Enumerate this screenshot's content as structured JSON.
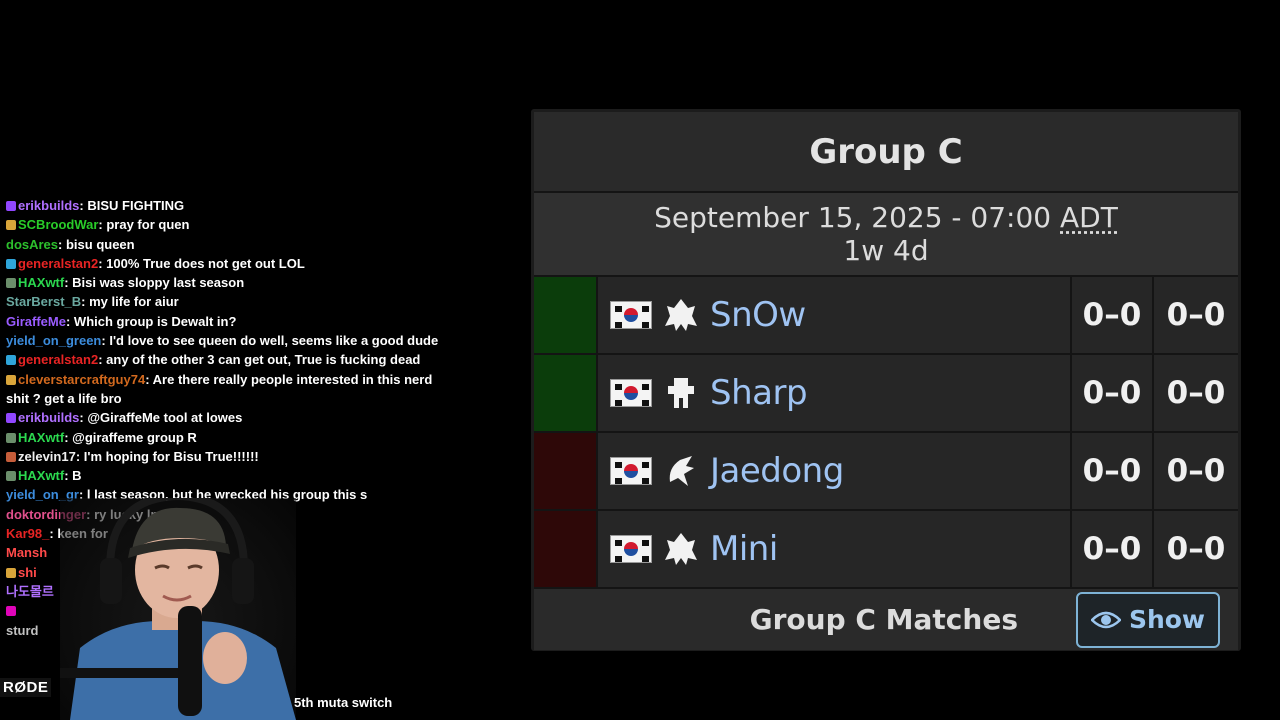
{
  "chat": {
    "messages": [
      {
        "badge": "sub",
        "user": "erikbuilds",
        "color": "#b070ff",
        "text": "BISU FIGHTING"
      },
      {
        "badge": "bits",
        "user": "SCBroodWar",
        "color": "#29cc29",
        "text": "pray for quen"
      },
      {
        "badge": "",
        "user": "dosAres",
        "color": "#2dc02d",
        "text": "bisu queen"
      },
      {
        "badge": "prime",
        "user": "generalstan2",
        "color": "#e82424",
        "text": "100% True does not get out LOL"
      },
      {
        "badge": "gift",
        "user": "HAXwtf",
        "color": "#2bd84f",
        "text": "Bisi was sloppy last season"
      },
      {
        "badge": "",
        "user": "StarBerst_B",
        "color": "#6aa8a0",
        "text": "my life for aiur"
      },
      {
        "badge": "",
        "user": "GiraffeMe",
        "color": "#9a5cff",
        "text": "Which group is Dewalt in?"
      },
      {
        "badge": "",
        "user": "yield_on_green",
        "color": "#3c8cdc",
        "text": "I'd love to see queen do well, seems like a good dude"
      },
      {
        "badge": "prime",
        "user": "generalstan2",
        "color": "#e82424",
        "text": "any of the other 3 can get out, True is fucking dead"
      },
      {
        "badge": "bits",
        "user": "cleverstarcraftguy74",
        "color": "#d2691e",
        "text": "Are there really people interested in this nerd shit ? get a life bro"
      },
      {
        "badge": "sub",
        "user": "erikbuilds",
        "color": "#b070ff",
        "text": "@GiraffeMe tool at lowes"
      },
      {
        "badge": "gift",
        "user": "HAXwtf",
        "color": "#2bd84f",
        "text": "@giraffeme group R"
      },
      {
        "badge": "mod",
        "user": "zelevin17",
        "color": "#f0f0f0",
        "text": "I'm hoping for Bisu True!!!!!!"
      },
      {
        "badge": "gift",
        "user": "HAXwtf",
        "color": "#2bd84f",
        "text": "B"
      },
      {
        "badge": "",
        "user": "yield_on_gr",
        "color": "#3c8cdc",
        "text": "l last season, but he wrecked his group this s"
      },
      {
        "badge": "",
        "user": "doktordinger",
        "color": "#e0508c",
        "text": "ry lucky lmao"
      },
      {
        "badge": "",
        "user": "Kar98_",
        "color": "#e82424",
        "text": "keen for"
      },
      {
        "badge": "",
        "user": "Mansh",
        "color": "#ff4a4a",
        "text": ""
      },
      {
        "badge": "bits",
        "user": "shi",
        "color": "#ff4a4a",
        "text": ""
      },
      {
        "badge": "",
        "user": "나도몰르",
        "color": "#b070ff",
        "text": ""
      },
      {
        "badge": "vip",
        "user": "",
        "color": "#b070ff",
        "text": ""
      },
      {
        "badge": "",
        "user": "sturd",
        "color": "#c0c0c0",
        "text": ""
      }
    ]
  },
  "webcam": {
    "mic_brand": "RØDE"
  },
  "overlay_text": "5th muta switch",
  "group": {
    "title": "Group C",
    "date": "September 15, 2025 - 07:00",
    "timezone": "ADT",
    "countdown": "1w 4d",
    "players": [
      {
        "name": "SnOw",
        "race": "protoss-icon",
        "status": "up",
        "match_score": "0–0",
        "game_score": "0–0"
      },
      {
        "name": "Sharp",
        "race": "terran-icon",
        "status": "up",
        "match_score": "0–0",
        "game_score": "0–0"
      },
      {
        "name": "Jaedong",
        "race": "zerg-icon",
        "status": "down",
        "match_score": "0–0",
        "game_score": "0–0"
      },
      {
        "name": "Mini",
        "race": "protoss-icon",
        "status": "down",
        "match_score": "0–0",
        "game_score": "0–0"
      }
    ],
    "matches_label": "Group C Matches",
    "show_label": "Show",
    "colors": {
      "advance": "#0b3d0b",
      "eliminate": "#2e0808",
      "link": "#9fc3f2"
    }
  }
}
